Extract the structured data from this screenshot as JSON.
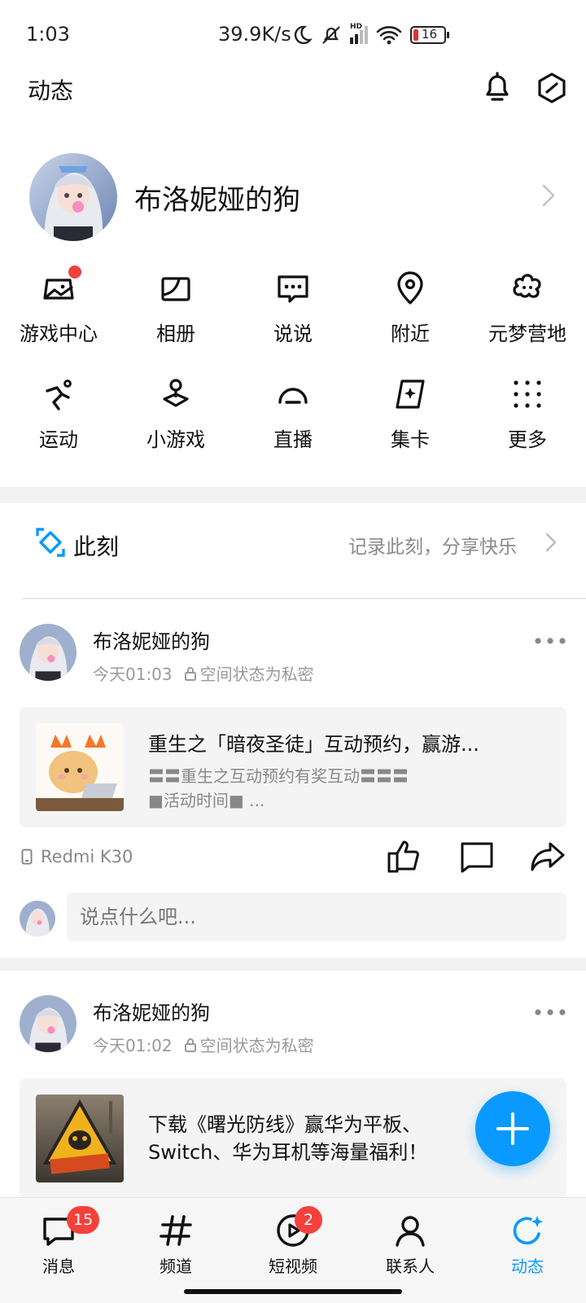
{
  "status_bar": {
    "time": "1:03",
    "speed": "39.9K/s",
    "battery": "16",
    "hd_label": "HD",
    "icons": [
      "moon-icon",
      "mute-bell-icon",
      "signal-icon",
      "wifi-icon",
      "battery-icon"
    ]
  },
  "header": {
    "title": "动态",
    "icons": [
      "bell-icon",
      "hexagon-icon"
    ]
  },
  "profile": {
    "name": "布洛妮娅的狗"
  },
  "apps": [
    {
      "label": "游戏中心",
      "icon": "gamepad-icon",
      "has_dot": true
    },
    {
      "label": "相册",
      "icon": "album-icon"
    },
    {
      "label": "说说",
      "icon": "chat-bubble-icon"
    },
    {
      "label": "附近",
      "icon": "location-pin-icon"
    },
    {
      "label": "元梦营地",
      "icon": "flower-cloud-icon"
    },
    {
      "label": "运动",
      "icon": "running-icon"
    },
    {
      "label": "小游戏",
      "icon": "joystick-icon"
    },
    {
      "label": "直播",
      "icon": "live-icon"
    },
    {
      "label": "集卡",
      "icon": "card-sparkle-icon"
    },
    {
      "label": "更多",
      "icon": "grid-dots-icon"
    }
  ],
  "moment": {
    "label": "此刻",
    "hint": "记录此刻，分享快乐"
  },
  "posts": [
    {
      "author": "布洛妮娅的狗",
      "time": "今天01:03",
      "privacy": "空间状态为私密",
      "card_title": "重生之「暗夜圣徒」互动预约，赢游...",
      "card_sub_line1": "〓〓重生之互动预约有奖互动〓〓〓",
      "card_sub_line2": "■活动时间■ ...",
      "device": "Redmi K30",
      "comment_placeholder": "说点什么吧..."
    },
    {
      "author": "布洛妮娅的狗",
      "time": "今天01:02",
      "privacy": "空间状态为私密",
      "card_line1": "下载《曙光防线》赢华为平板、",
      "card_line2": "Switch、华为耳机等海量福利！"
    }
  ],
  "nav": [
    {
      "label": "消息",
      "icon": "message-icon",
      "badge": "15"
    },
    {
      "label": "频道",
      "icon": "hash-icon"
    },
    {
      "label": "短视频",
      "icon": "video-icon",
      "badge": "2"
    },
    {
      "label": "联系人",
      "icon": "person-icon"
    },
    {
      "label": "动态",
      "icon": "refresh-star-icon",
      "active": true
    }
  ],
  "colors": {
    "accent": "#0a99ff",
    "badge": "#f5413b",
    "divider": "#f2f2f2"
  }
}
